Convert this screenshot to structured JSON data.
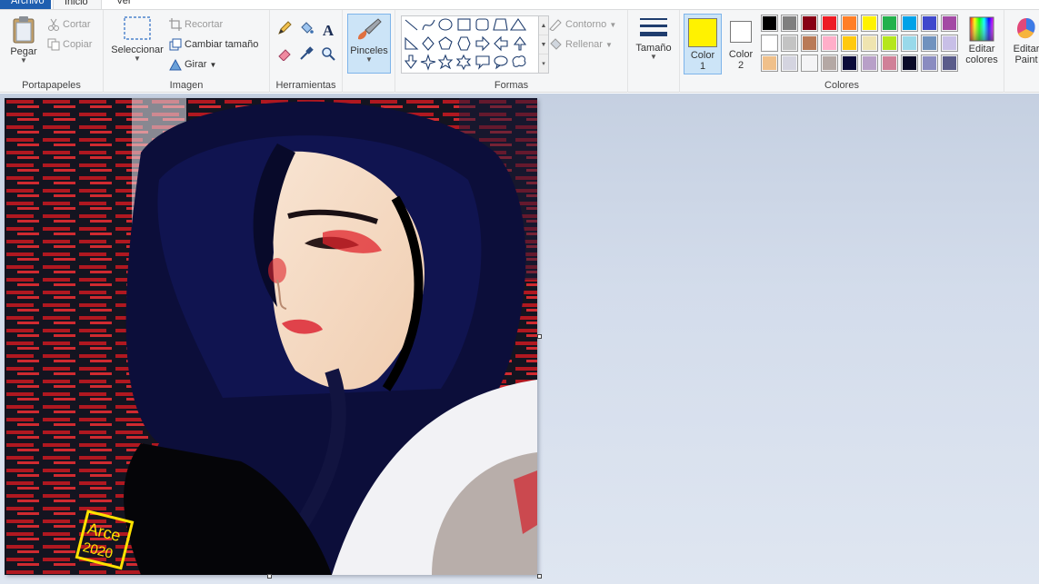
{
  "tabs": {
    "archivo": "Archivo",
    "inicio": "Inicio",
    "ver": "Ver"
  },
  "portapapeles": {
    "label": "Portapapeles",
    "pegar": "Pegar",
    "cortar": "Cortar",
    "copiar": "Copiar"
  },
  "imagen": {
    "label": "Imagen",
    "seleccionar": "Seleccionar",
    "recortar": "Recortar",
    "cambiar_tamano": "Cambiar tamaño",
    "girar": "Girar"
  },
  "herramientas": {
    "label": "Herramientas",
    "tools": [
      "pencil-icon",
      "fill-bucket-icon",
      "text-icon",
      "eraser-icon",
      "color-picker-icon",
      "magnifier-icon"
    ]
  },
  "pinceles": {
    "label": "Pinceles"
  },
  "formas": {
    "label": "Formas",
    "contorno": "Contorno",
    "rellenar": "Rellenar"
  },
  "tamano": {
    "label": "Tamaño"
  },
  "colores": {
    "label": "Colores",
    "color1_label": "Color 1",
    "color1_line1": "Color",
    "color1_line2": "1",
    "color2_line1": "Color",
    "color2_line2": "2",
    "color1_value": "#fff200",
    "color2_value": "#ffffff",
    "editar_line1": "Editar",
    "editar_line2": "colores",
    "row1": [
      "#000000",
      "#7f7f7f",
      "#880015",
      "#ed1c24",
      "#ff7f27",
      "#fff200",
      "#22b14c",
      "#00a2e8",
      "#3f48cc",
      "#a349a4"
    ],
    "row2": [
      "#ffffff",
      "#c3c3c3",
      "#b97a57",
      "#ffaec9",
      "#ffc90e",
      "#efe4b0",
      "#b5e61d",
      "#99d9ea",
      "#7092be",
      "#c8bfe7"
    ],
    "row3": [
      "#f0c08a",
      "#d4d4e0",
      "#f4f4f6",
      "#b4a8a4",
      "#0a0a3a",
      "#b8a0c8",
      "#d08098",
      "#0a0a28",
      "#8a8cc0",
      "#5a5c8a"
    ]
  },
  "paint3d": {
    "line1": "Editar",
    "line2": "Paint"
  },
  "artwork": {
    "signature_name": "Arce",
    "signature_year": "2020"
  }
}
